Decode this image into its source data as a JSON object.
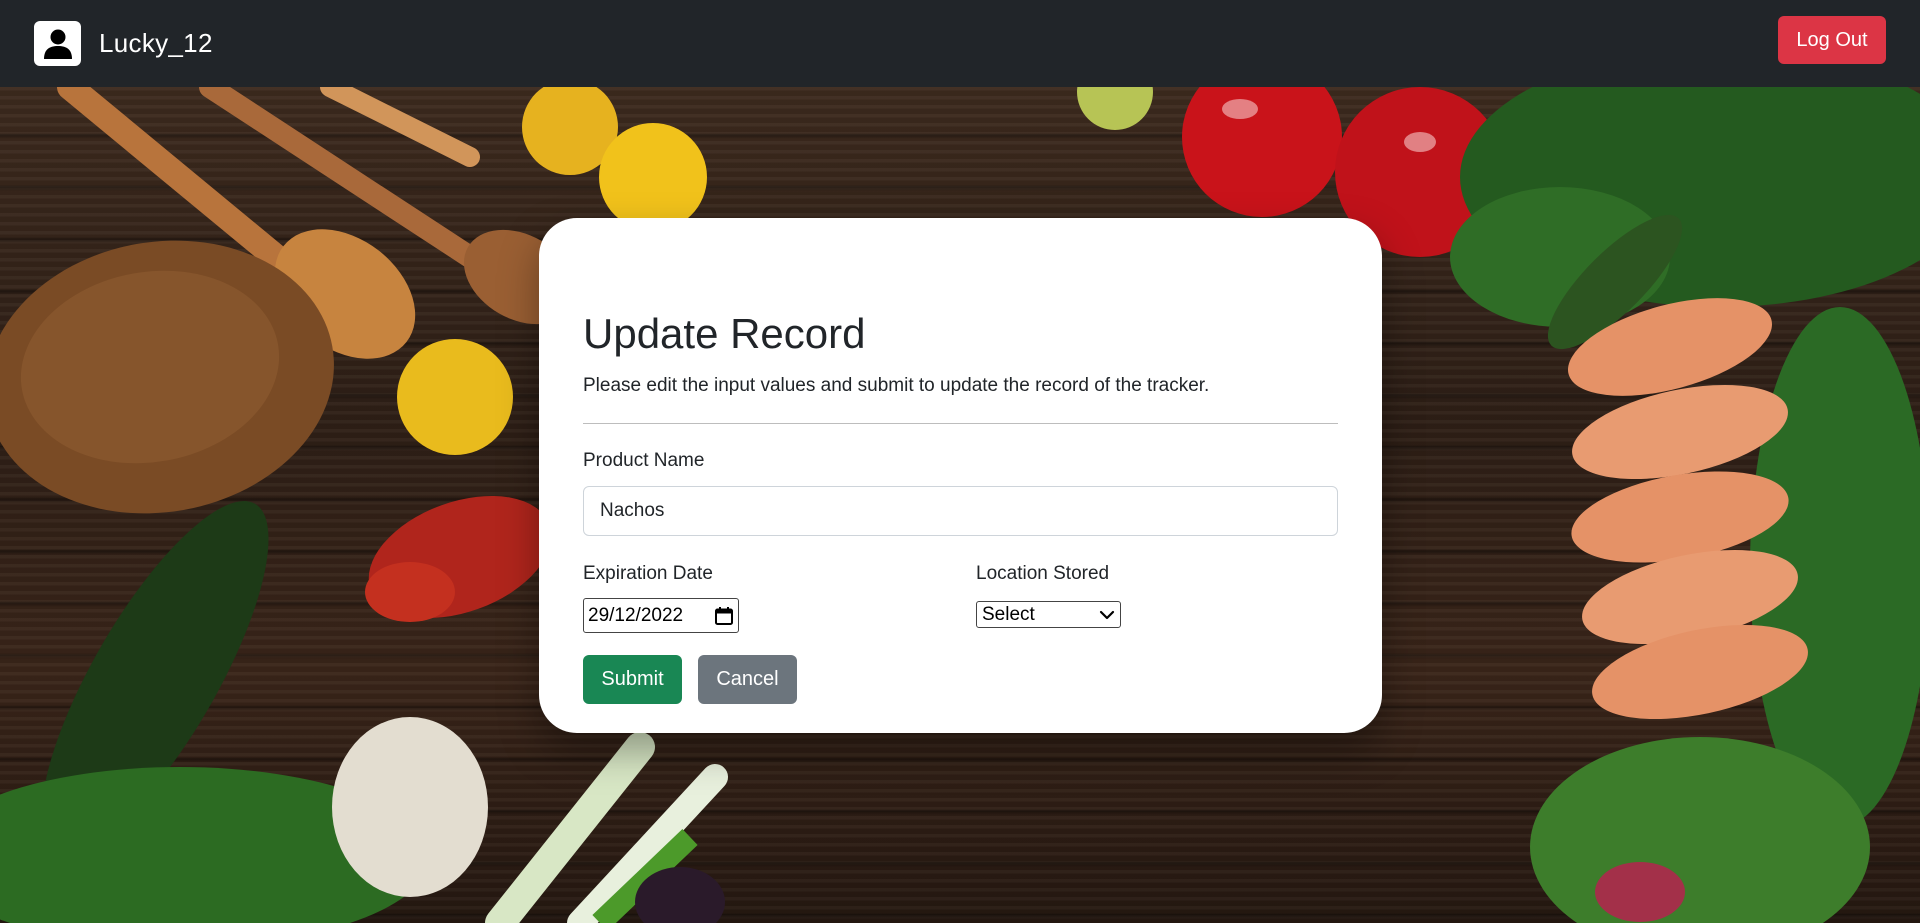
{
  "navbar": {
    "username": "Lucky_12",
    "logout_label": "Log Out",
    "avatar_icon": "user-icon"
  },
  "form": {
    "title": "Update Record",
    "subtitle": "Please edit the input values and submit to update the record of the tracker.",
    "product_name_label": "Product Name",
    "product_name_value": "Nachos",
    "expiration_label": "Expiration Date",
    "expiration_value": "29/12/2022",
    "location_label": "Location Stored",
    "location_value": "Select",
    "submit_label": "Submit",
    "cancel_label": "Cancel"
  },
  "colors": {
    "navbar": "#212529",
    "logout": "#dc3545",
    "submit": "#198754",
    "cancel": "#6c757d"
  }
}
